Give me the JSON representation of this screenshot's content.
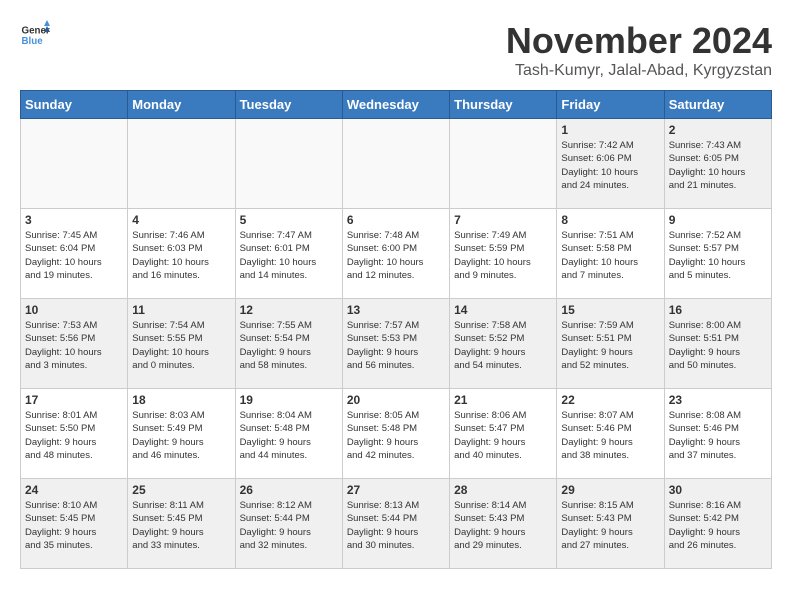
{
  "header": {
    "logo_general": "General",
    "logo_blue": "Blue",
    "month": "November 2024",
    "location": "Tash-Kumyr, Jalal-Abad, Kyrgyzstan"
  },
  "weekdays": [
    "Sunday",
    "Monday",
    "Tuesday",
    "Wednesday",
    "Thursday",
    "Friday",
    "Saturday"
  ],
  "weeks": [
    [
      {
        "day": "",
        "info": "",
        "empty": true
      },
      {
        "day": "",
        "info": "",
        "empty": true
      },
      {
        "day": "",
        "info": "",
        "empty": true
      },
      {
        "day": "",
        "info": "",
        "empty": true
      },
      {
        "day": "",
        "info": "",
        "empty": true
      },
      {
        "day": "1",
        "info": "Sunrise: 7:42 AM\nSunset: 6:06 PM\nDaylight: 10 hours\nand 24 minutes."
      },
      {
        "day": "2",
        "info": "Sunrise: 7:43 AM\nSunset: 6:05 PM\nDaylight: 10 hours\nand 21 minutes."
      }
    ],
    [
      {
        "day": "3",
        "info": "Sunrise: 7:45 AM\nSunset: 6:04 PM\nDaylight: 10 hours\nand 19 minutes."
      },
      {
        "day": "4",
        "info": "Sunrise: 7:46 AM\nSunset: 6:03 PM\nDaylight: 10 hours\nand 16 minutes."
      },
      {
        "day": "5",
        "info": "Sunrise: 7:47 AM\nSunset: 6:01 PM\nDaylight: 10 hours\nand 14 minutes."
      },
      {
        "day": "6",
        "info": "Sunrise: 7:48 AM\nSunset: 6:00 PM\nDaylight: 10 hours\nand 12 minutes."
      },
      {
        "day": "7",
        "info": "Sunrise: 7:49 AM\nSunset: 5:59 PM\nDaylight: 10 hours\nand 9 minutes."
      },
      {
        "day": "8",
        "info": "Sunrise: 7:51 AM\nSunset: 5:58 PM\nDaylight: 10 hours\nand 7 minutes."
      },
      {
        "day": "9",
        "info": "Sunrise: 7:52 AM\nSunset: 5:57 PM\nDaylight: 10 hours\nand 5 minutes."
      }
    ],
    [
      {
        "day": "10",
        "info": "Sunrise: 7:53 AM\nSunset: 5:56 PM\nDaylight: 10 hours\nand 3 minutes."
      },
      {
        "day": "11",
        "info": "Sunrise: 7:54 AM\nSunset: 5:55 PM\nDaylight: 10 hours\nand 0 minutes."
      },
      {
        "day": "12",
        "info": "Sunrise: 7:55 AM\nSunset: 5:54 PM\nDaylight: 9 hours\nand 58 minutes."
      },
      {
        "day": "13",
        "info": "Sunrise: 7:57 AM\nSunset: 5:53 PM\nDaylight: 9 hours\nand 56 minutes."
      },
      {
        "day": "14",
        "info": "Sunrise: 7:58 AM\nSunset: 5:52 PM\nDaylight: 9 hours\nand 54 minutes."
      },
      {
        "day": "15",
        "info": "Sunrise: 7:59 AM\nSunset: 5:51 PM\nDaylight: 9 hours\nand 52 minutes."
      },
      {
        "day": "16",
        "info": "Sunrise: 8:00 AM\nSunset: 5:51 PM\nDaylight: 9 hours\nand 50 minutes."
      }
    ],
    [
      {
        "day": "17",
        "info": "Sunrise: 8:01 AM\nSunset: 5:50 PM\nDaylight: 9 hours\nand 48 minutes."
      },
      {
        "day": "18",
        "info": "Sunrise: 8:03 AM\nSunset: 5:49 PM\nDaylight: 9 hours\nand 46 minutes."
      },
      {
        "day": "19",
        "info": "Sunrise: 8:04 AM\nSunset: 5:48 PM\nDaylight: 9 hours\nand 44 minutes."
      },
      {
        "day": "20",
        "info": "Sunrise: 8:05 AM\nSunset: 5:48 PM\nDaylight: 9 hours\nand 42 minutes."
      },
      {
        "day": "21",
        "info": "Sunrise: 8:06 AM\nSunset: 5:47 PM\nDaylight: 9 hours\nand 40 minutes."
      },
      {
        "day": "22",
        "info": "Sunrise: 8:07 AM\nSunset: 5:46 PM\nDaylight: 9 hours\nand 38 minutes."
      },
      {
        "day": "23",
        "info": "Sunrise: 8:08 AM\nSunset: 5:46 PM\nDaylight: 9 hours\nand 37 minutes."
      }
    ],
    [
      {
        "day": "24",
        "info": "Sunrise: 8:10 AM\nSunset: 5:45 PM\nDaylight: 9 hours\nand 35 minutes."
      },
      {
        "day": "25",
        "info": "Sunrise: 8:11 AM\nSunset: 5:45 PM\nDaylight: 9 hours\nand 33 minutes."
      },
      {
        "day": "26",
        "info": "Sunrise: 8:12 AM\nSunset: 5:44 PM\nDaylight: 9 hours\nand 32 minutes."
      },
      {
        "day": "27",
        "info": "Sunrise: 8:13 AM\nSunset: 5:44 PM\nDaylight: 9 hours\nand 30 minutes."
      },
      {
        "day": "28",
        "info": "Sunrise: 8:14 AM\nSunset: 5:43 PM\nDaylight: 9 hours\nand 29 minutes."
      },
      {
        "day": "29",
        "info": "Sunrise: 8:15 AM\nSunset: 5:43 PM\nDaylight: 9 hours\nand 27 minutes."
      },
      {
        "day": "30",
        "info": "Sunrise: 8:16 AM\nSunset: 5:42 PM\nDaylight: 9 hours\nand 26 minutes."
      }
    ]
  ]
}
